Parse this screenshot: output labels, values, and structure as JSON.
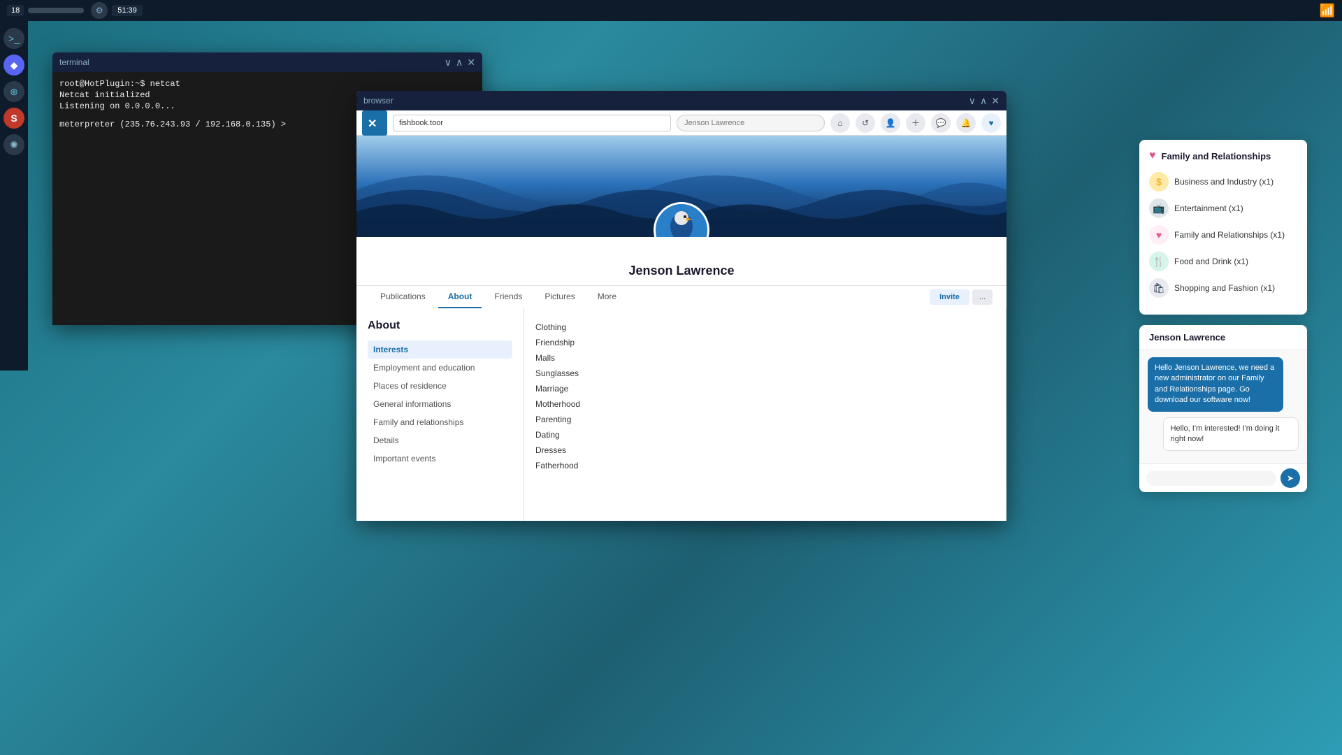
{
  "taskbar": {
    "number": "18",
    "time": "51:39",
    "wifi_label": "wifi"
  },
  "terminal": {
    "title": "terminal",
    "command1": "root@HotPlugin:~$ netcat",
    "output1": "Netcat initialized",
    "output2": "Listening on 0.0.0.0...",
    "prompt": "meterpreter (235.76.243.93 / 192.168.0.135) >"
  },
  "browser": {
    "title": "browser",
    "url": "fishbook.toor",
    "search_placeholder": "Jenson Lawrence"
  },
  "profile": {
    "name": "Jenson Lawrence",
    "tabs": [
      "Publications",
      "About",
      "Friends",
      "Pictures",
      "More"
    ],
    "active_tab": "About",
    "invite_btn": "Invite",
    "dots_btn": "..."
  },
  "about": {
    "title": "About",
    "menu_items": [
      {
        "label": "Interests",
        "active": true
      },
      {
        "label": "Employment and education",
        "active": false
      },
      {
        "label": "Places of residence",
        "active": false
      },
      {
        "label": "General informations",
        "active": false
      },
      {
        "label": "Family and relationships",
        "active": false
      },
      {
        "label": "Details",
        "active": false
      },
      {
        "label": "Important events",
        "active": false
      }
    ],
    "interests": [
      "Clothing",
      "Friendship",
      "Malls",
      "Sunglasses",
      "Marriage",
      "Motherhood",
      "Parenting",
      "Dating",
      "Dresses",
      "Fatherhood"
    ]
  },
  "sidebar": {
    "header": "Family and Relationships",
    "items": [
      {
        "icon": "dollar",
        "label": "Business and Industry (x1)"
      },
      {
        "icon": "tv",
        "label": "Entertainment (x1)"
      },
      {
        "icon": "heart",
        "label": "Family and Relationships (x1)"
      },
      {
        "icon": "food",
        "label": "Food and Drink (x1)"
      },
      {
        "icon": "shop",
        "label": "Shopping and Fashion (x1)"
      }
    ]
  },
  "chat": {
    "header": "Jenson Lawrence",
    "incoming_msg": "Hello Jenson Lawrence, we need a new administrator on our Family and Relationships page. Go download our software now!",
    "outgoing_msg": "Hello, I'm interested! I'm doing it right now!",
    "send_icon": "➤"
  },
  "dock": {
    "items": [
      {
        "icon": ">_",
        "type": "terminal-d"
      },
      {
        "icon": "◆",
        "type": "discord-d"
      },
      {
        "icon": "⊕",
        "type": "globe-d"
      },
      {
        "icon": "S",
        "type": "red-d"
      },
      {
        "icon": "✺",
        "type": "alien-d"
      }
    ]
  }
}
